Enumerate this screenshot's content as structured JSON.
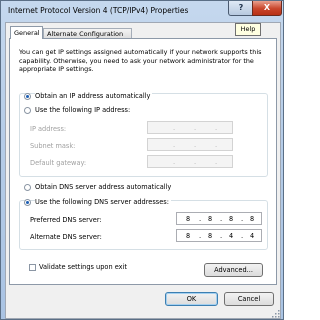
{
  "window": {
    "title": "Internet Protocol Version 4 (TCP/IPv4) Properties",
    "help_glyph": "?",
    "close_glyph": "X",
    "help_tooltip": "Help"
  },
  "tabs": [
    "General",
    "Alternate Configuration"
  ],
  "description": "You can get IP settings assigned automatically if your network supports this capability. Otherwise, you need to ask your network administrator for the appropriate IP settings.",
  "ip": {
    "auto_label": "Obtain an IP address automatically",
    "manual_label": "Use the following IP address:",
    "selected": "auto",
    "fields": [
      {
        "label": "IP address:",
        "value": [
          "",
          "",
          "",
          ""
        ]
      },
      {
        "label": "Subnet mask:",
        "value": [
          "",
          "",
          "",
          ""
        ]
      },
      {
        "label": "Default gateway:",
        "value": [
          "",
          "",
          "",
          ""
        ]
      }
    ]
  },
  "dns": {
    "auto_label": "Obtain DNS server address automatically",
    "manual_label": "Use the following DNS server addresses:",
    "selected": "manual",
    "preferred_label": "Preferred DNS server:",
    "preferred": [
      "8",
      "8",
      "8",
      "8"
    ],
    "alternate_label": "Alternate DNS server:",
    "alternate": [
      "8",
      "8",
      "4",
      "4"
    ]
  },
  "validate_label": "Validate settings upon exit",
  "validate_checked": false,
  "buttons": {
    "advanced": "Advanced...",
    "ok": "OK",
    "cancel": "Cancel"
  },
  "colors": {
    "accent": "#1e5fb4",
    "title_bar": "#b6cde8",
    "close": "#c8452b"
  }
}
